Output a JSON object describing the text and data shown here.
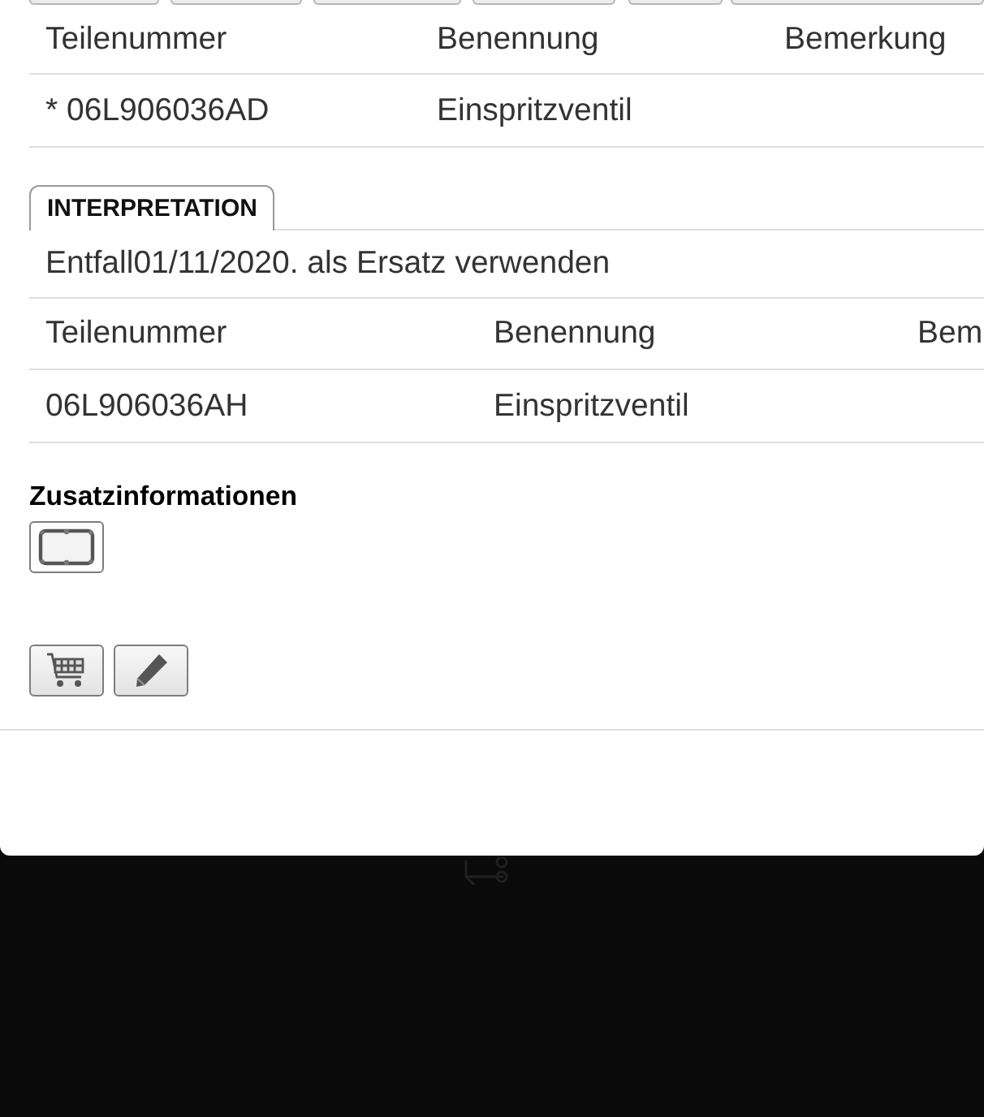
{
  "parts_table": {
    "columns": [
      "Teilenummer",
      "Benennung",
      "Bemerkung"
    ],
    "rows": [
      {
        "cells": [
          "* 06L906036AD",
          "Einspritzventil"
        ]
      }
    ]
  },
  "tabs": [
    {
      "label": "INTERPRETATION",
      "selected": true
    }
  ],
  "note": "Entfall01/11/2020. als Ersatz verwenden",
  "replacement_table": {
    "columns": [
      "Teilenummer",
      "Benennung",
      "Bem"
    ],
    "rows": [
      {
        "cells": [
          "06L906036AH",
          "Einspritzventil"
        ]
      }
    ]
  },
  "additional_info": {
    "title": "Zusatzinformationen"
  }
}
